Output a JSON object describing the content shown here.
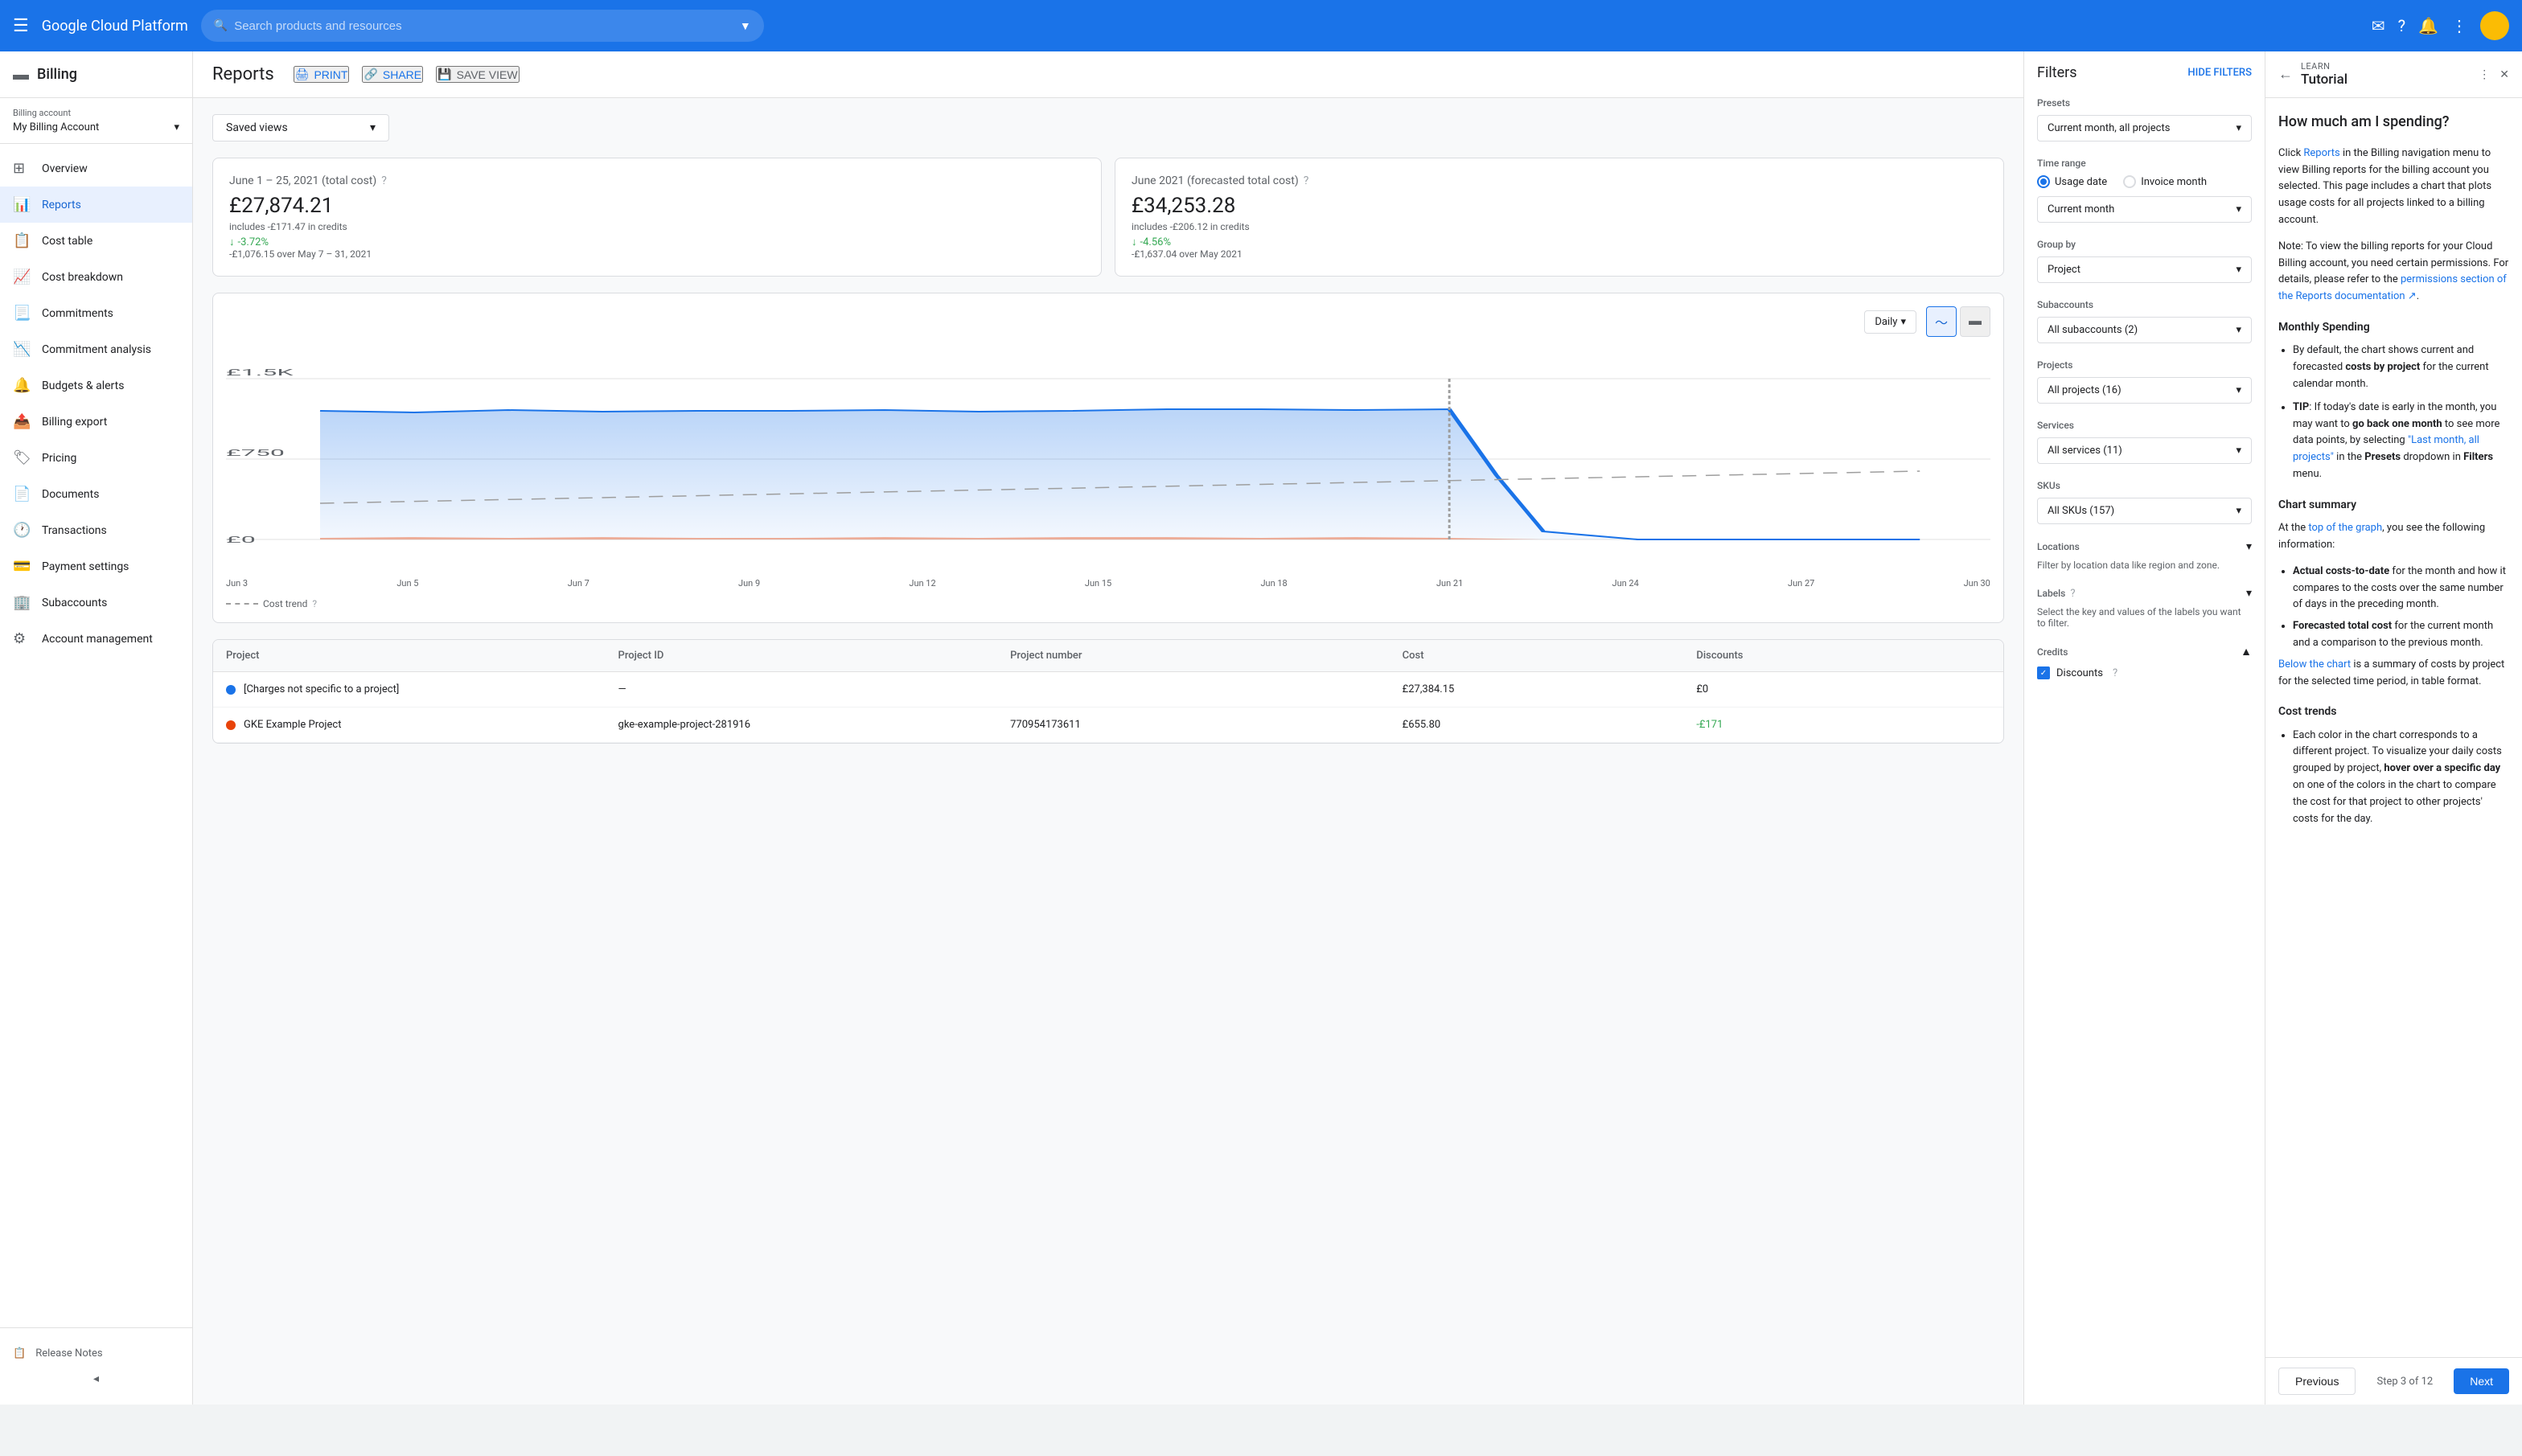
{
  "topNav": {
    "hamburger": "☰",
    "logo": "Google Cloud Platform",
    "searchPlaceholder": "Search products and resources",
    "icons": [
      "email-icon",
      "help-icon",
      "bell-icon",
      "more-icon"
    ]
  },
  "sidebar": {
    "billingTitle": "Billing",
    "billingAccountLabel": "Billing account",
    "billingAccountName": "My Billing Account",
    "navItems": [
      {
        "id": "overview",
        "label": "Overview",
        "icon": "⊞"
      },
      {
        "id": "reports",
        "label": "Reports",
        "icon": "📊",
        "active": true
      },
      {
        "id": "cost-table",
        "label": "Cost table",
        "icon": "📋"
      },
      {
        "id": "cost-breakdown",
        "label": "Cost breakdown",
        "icon": "📈"
      },
      {
        "id": "commitments",
        "label": "Commitments",
        "icon": "📃"
      },
      {
        "id": "commitment-analysis",
        "label": "Commitment analysis",
        "icon": "📉"
      },
      {
        "id": "budgets-alerts",
        "label": "Budgets & alerts",
        "icon": "🔔"
      },
      {
        "id": "billing-export",
        "label": "Billing export",
        "icon": "📤"
      },
      {
        "id": "pricing",
        "label": "Pricing",
        "icon": "🏷"
      },
      {
        "id": "documents",
        "label": "Documents",
        "icon": "📄"
      },
      {
        "id": "transactions",
        "label": "Transactions",
        "icon": "🕐"
      },
      {
        "id": "payment-settings",
        "label": "Payment settings",
        "icon": "💳"
      },
      {
        "id": "subaccounts",
        "label": "Subaccounts",
        "icon": "🏢"
      },
      {
        "id": "account-management",
        "label": "Account management",
        "icon": "⚙"
      }
    ],
    "footerItems": [
      {
        "id": "release-notes",
        "label": "Release Notes",
        "icon": "📋"
      }
    ]
  },
  "main": {
    "pageTitle": "Reports",
    "headerBtns": [
      {
        "id": "print",
        "label": "PRINT",
        "icon": "🖨"
      },
      {
        "id": "share",
        "label": "SHARE",
        "icon": "🔗"
      },
      {
        "id": "save-view",
        "label": "SAVE VIEW",
        "icon": "💾"
      }
    ],
    "savedViews": "Saved views",
    "summaryCards": [
      {
        "title": "June 1 – 25, 2021 (total cost)",
        "amount": "£27,874.21",
        "credits": "includes -£171.47 in credits",
        "change": "-3.72%",
        "compare": "-£1,076.15 over May 7 – 31, 2021"
      },
      {
        "title": "June 2021 (forecasted total cost)",
        "amount": "£34,253.28",
        "credits": "includes -£206.12 in credits",
        "change": "-4.56%",
        "compare": "-£1,637.04 over May 2021"
      }
    ],
    "chartControls": {
      "daily": "Daily",
      "chartTypes": [
        "line",
        "bar"
      ]
    },
    "chartYLabels": [
      "£1.5K",
      "£750",
      "£0"
    ],
    "chartXLabels": [
      "Jun 3",
      "Jun 5",
      "Jun 7",
      "Jun 9",
      "Jun 12",
      "Jun 15",
      "Jun 18",
      "Jun 21",
      "Jun 24",
      "Jun 27",
      "Jun 30"
    ],
    "costTrendLabel": "Cost trend",
    "tableHeaders": [
      "Project",
      "Project ID",
      "Project number",
      "Cost",
      "Discounts"
    ],
    "tableRows": [
      {
        "project": "[Charges not specific to a project]",
        "projectId": "—",
        "projectNumber": "",
        "cost": "£27,384.15",
        "discounts": "£0",
        "dotColor": "#1a73e8"
      },
      {
        "project": "GKE Example Project",
        "projectId": "gke-example-project-281916",
        "projectNumber": "770954173611",
        "cost": "£655.80",
        "discounts": "-£171",
        "dotColor": "#e8430a"
      }
    ]
  },
  "filters": {
    "title": "Filters",
    "hideFiltersLabel": "HIDE FILTERS",
    "presetsLabel": "Presets",
    "presetsValue": "Current month, all projects",
    "timeRangeLabel": "Time range",
    "timeRangeOptions": [
      "Usage date",
      "Invoice month"
    ],
    "selectedTimeRange": "Usage date",
    "currentMonthLabel": "Current month",
    "groupByLabel": "Group by",
    "groupByValue": "Project",
    "subaccountsLabel": "Subaccounts",
    "subaccountsValue": "All subaccounts (2)",
    "projectsLabel": "Projects",
    "projectsValue": "All projects (16)",
    "servicesLabel": "Services",
    "servicesValue": "All services (11)",
    "skusLabel": "SKUs",
    "skusValue": "All SKUs (157)",
    "locationsLabel": "Locations",
    "locationsDesc": "Filter by location data like region and zone.",
    "labelsLabel": "Labels",
    "labelsDesc": "Select the key and values of the labels you want to filter.",
    "creditsLabel": "Credits",
    "discountsLabel": "Discounts"
  },
  "tutorial": {
    "learnLabel": "LEARN",
    "title": "Tutorial",
    "mainHeading": "How much am I spending?",
    "paragraphs": [
      "Click Reports in the Billing navigation menu to view Billing reports for the billing account you selected. This page includes a chart that plots usage costs for all projects linked to a billing account.",
      "Note: To view the billing reports for your Cloud Billing account, you need certain permissions. For details, please refer to the permissions section of the Reports documentation ↗."
    ],
    "sections": [
      {
        "title": "Monthly Spending",
        "items": [
          "By default, the chart shows current and forecasted costs by project for the current calendar month.",
          "TIP: If today's date is early in the month, you may want to go back one month to see more data points, by selecting \"Last month, all projects\" in the Presets dropdown in Filters menu."
        ]
      },
      {
        "title": "Chart summary",
        "intro": "At the top of the graph, you see the following information:",
        "subItems": [
          "Actual costs-to-date for the month and how it compares to the costs over the same number of days in the preceding month.",
          "Forecasted total cost for the current month and a comparison to the previous month."
        ],
        "after": "Below the chart is a summary of costs by project for the selected time period, in table format."
      },
      {
        "title": "Cost trends",
        "items": [
          "Each color in the chart corresponds to a different project. To visualize your daily costs grouped by project, hover over a specific day on one of the colors in the chart to compare the cost for that project to other projects' costs for the day."
        ]
      }
    ],
    "footer": {
      "prevLabel": "Previous",
      "stepLabel": "Step 3 of 12",
      "nextLabel": "Next"
    }
  }
}
